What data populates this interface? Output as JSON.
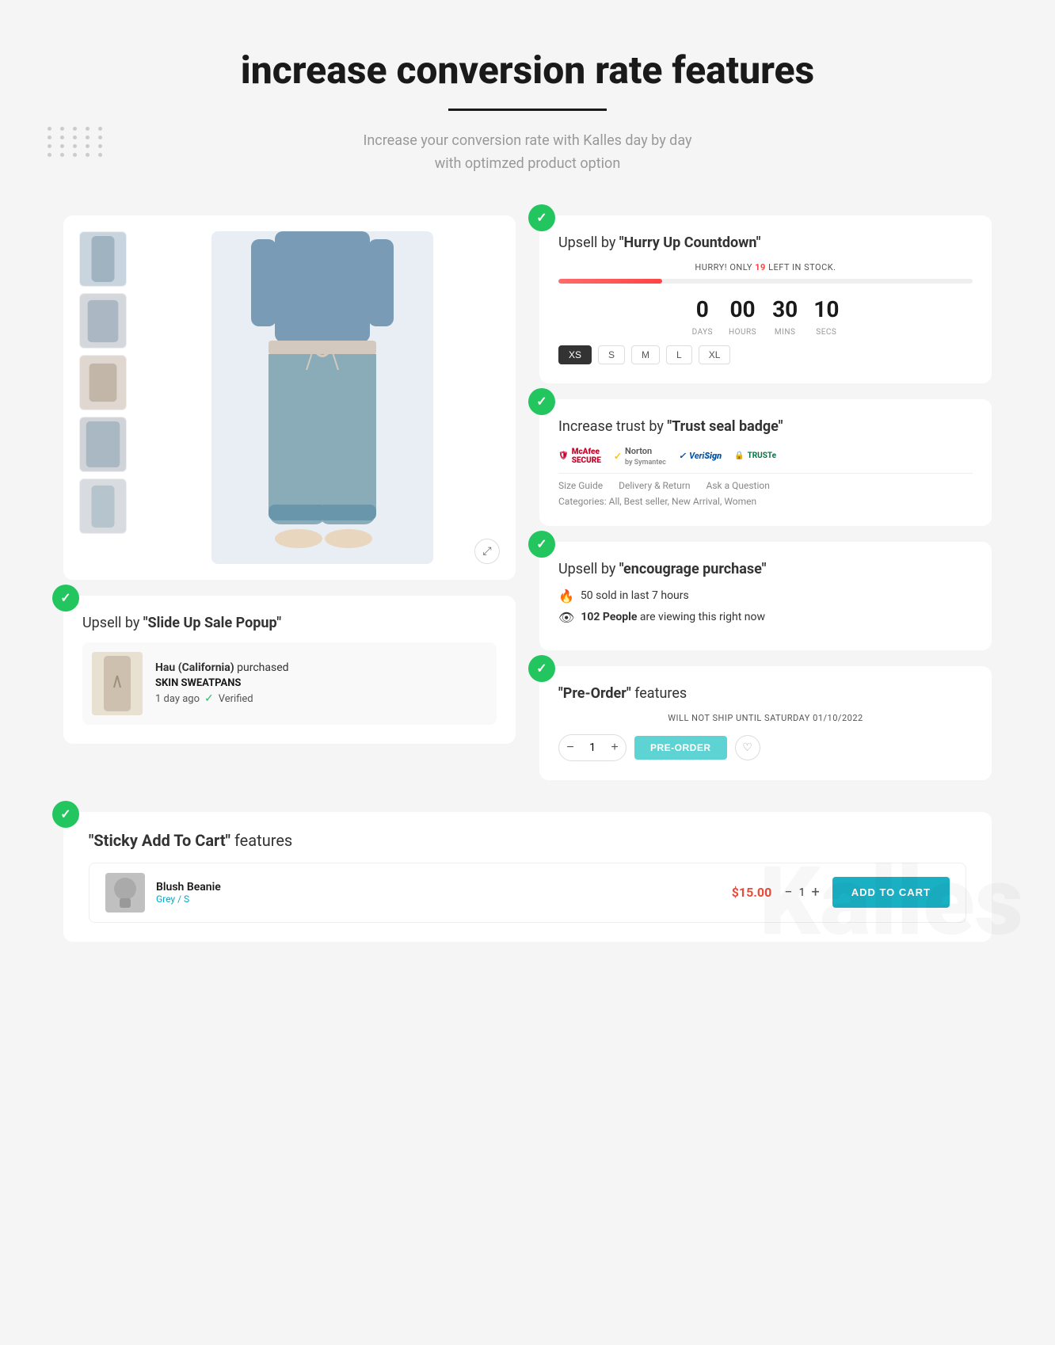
{
  "header": {
    "title": "increase conversion rate features",
    "subtitle_line1": "Increase your conversion rate with Kalles  day by day",
    "subtitle_line2": "with optimzed product option"
  },
  "features": {
    "feature1": {
      "check": "✓",
      "title_prefix": "Upsell by ",
      "title_bold": "\"Hurry Up Countdown\"",
      "hurry_text": "HURRY! ONLY ",
      "stock_num": "19",
      "stock_suffix": " LEFT IN STOCK.",
      "countdown": {
        "days": "0",
        "days_label": "DAYS",
        "hours": "00",
        "hours_label": "HOURS",
        "mins": "30",
        "mins_label": "MINS",
        "secs": "10",
        "secs_label": "SECS"
      },
      "sizes": [
        "XS",
        "S",
        "M",
        "L",
        "XL"
      ]
    },
    "feature2": {
      "check": "✓",
      "title_prefix": "Increase trust by ",
      "title_bold": "\"Trust seal badge\"",
      "badges": [
        {
          "name": "McAfee SECURE",
          "symbol": "🛡"
        },
        {
          "name": "Norton by Symantec",
          "symbol": "✓"
        },
        {
          "name": "VeriSign",
          "symbol": "✓"
        },
        {
          "name": "TRUSTe",
          "symbol": "🔒"
        }
      ],
      "tabs": [
        "Size Guide",
        "Delivery & Return",
        "Ask a Question"
      ],
      "categories": "Categories: All, Best seller, New Arrival, Women"
    },
    "feature3": {
      "check": "✓",
      "title_prefix": "Upsell by ",
      "title_bold": "\"encougrage purchase\"",
      "items": [
        {
          "icon": "🔥",
          "text": "50 sold in last 7 hours"
        },
        {
          "icon": "👁",
          "text": "102 People are viewing this right now",
          "bold": "102 People"
        }
      ]
    },
    "feature4": {
      "check": "✓",
      "title_left": "\"Pre-Order\"",
      "title_right": " features",
      "ship_date": "WILL NOT SHIP UNTIL SATURDAY 01/10/2022",
      "qty": "1",
      "preorder_label": "PRE-ORDER"
    }
  },
  "popup": {
    "check": "✓",
    "title_prefix": "Upsell by ",
    "title_bold": "\"Slide Up Sale Popup\"",
    "customer": "Hau (California)",
    "purchased": "purchased",
    "product_name": "SKIN SWEATPANS",
    "time_ago": "1 day ago",
    "verified": "Verified"
  },
  "sticky": {
    "check": "✓",
    "title_bold": "\"Sticky Add To Cart\"",
    "title_suffix": " features",
    "product_name": "Blush Beanie",
    "variant": "Grey / S",
    "price": "$15.00",
    "qty": "1",
    "add_to_cart": "ADD TO CART"
  }
}
